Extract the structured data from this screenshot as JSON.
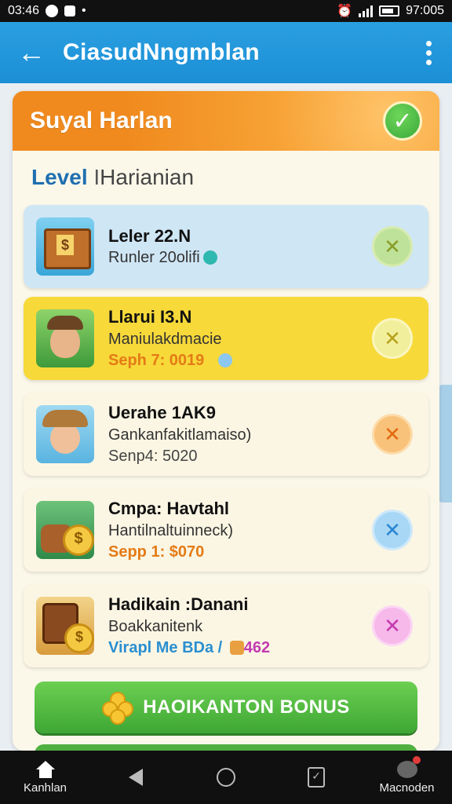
{
  "status_bar": {
    "left_text": "03:46",
    "right_text": "97:005"
  },
  "app_bar": {
    "title": "CiasudNngmblan",
    "back_icon": "arrow-left-icon",
    "menu_icon": "more-vert-icon"
  },
  "card": {
    "title": "Suyal Harlan",
    "badge_icon": "check-icon",
    "level_label": "Level",
    "level_separator": "I",
    "level_value": "Harianian"
  },
  "tasks": [
    {
      "title": "Leler 22.N",
      "subtitle": "Runler 20olifi",
      "detail": "",
      "detail_color": "",
      "bg": "#cfe6f5",
      "action_bg": "#bfe29a",
      "action_color": "#8a9d2a",
      "thumb": "chest",
      "sub_icon_color": "#2fb8b0"
    },
    {
      "title": "Llarui I3.N",
      "subtitle": "Maniulakdmacie",
      "detail": "Seph 7: 0019",
      "detail_color": "#e47b16",
      "bg": "#f7d93a",
      "action_bg": "#f2ef9c",
      "action_color": "#b8a21c",
      "thumb": "boy",
      "sub_icon_color": ""
    },
    {
      "title": "Uerahe 1AK9",
      "subtitle": "Gankanfakitlamaiso)",
      "detail": "Senp4: 5020",
      "detail_color": "#444",
      "bg": "#fbf6e4",
      "action_bg": "#f9c27a",
      "action_color": "#e06a10",
      "thumb": "girl",
      "sub_icon_color": ""
    },
    {
      "title": "Cmpa: Havtahl",
      "subtitle": "Hantilnaltuinneck)",
      "detail": "Sepp 1: $070",
      "detail_color": "#e47b16",
      "bg": "#fbf6e4",
      "action_bg": "#a8d7f5",
      "action_color": "#2a86d0",
      "thumb": "coins",
      "sub_icon_color": ""
    },
    {
      "title": "Hadikain :Danani",
      "subtitle": "Boakkanitenk",
      "detail": "Virapl Me BDa /",
      "detail_extra": "462",
      "detail_color": "#2a8fd0",
      "bg": "#fbf6e4",
      "action_bg": "#f7b8ea",
      "action_color": "#c23ab0",
      "thumb": "bag",
      "sub_icon_color": ""
    }
  ],
  "bonus_button": {
    "label": "HAOIKANTON BONUS",
    "icon": "clover-icon"
  },
  "bottom_nav": {
    "home_label": "Kanhlan",
    "chat_label": "Macnoden"
  }
}
